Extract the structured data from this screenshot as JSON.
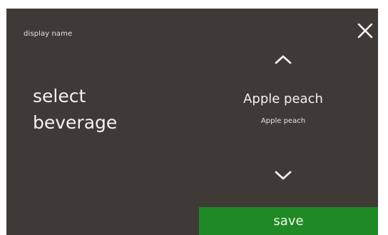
{
  "header": {
    "label": "display name"
  },
  "main": {
    "prompt_line1": "select",
    "prompt_line2": "beverage"
  },
  "beverage_picker": {
    "selected_name": "Apple peach",
    "selected_subtitle": "Apple peach",
    "up_icon": "chevron-up-icon",
    "down_icon": "chevron-down-icon"
  },
  "actions": {
    "save_label": "save",
    "close_icon": "close-icon"
  },
  "colors": {
    "background": "#403a37",
    "text": "#f4f1ee",
    "save_button": "#1f8a25"
  }
}
